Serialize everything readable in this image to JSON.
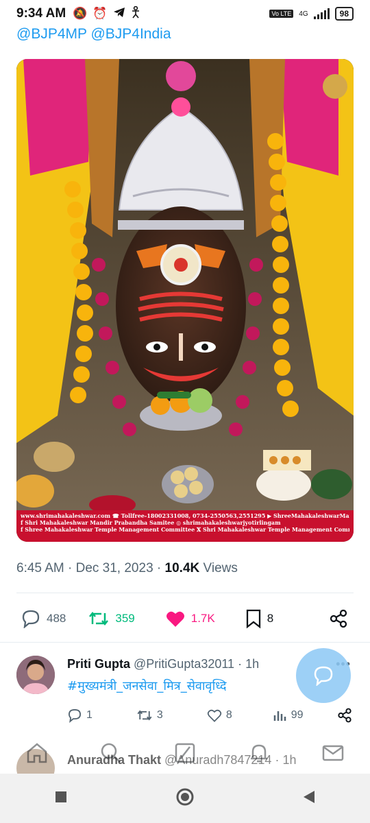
{
  "status_bar": {
    "time": "9:34 AM",
    "icons": [
      "mute-icon",
      "alarm-icon",
      "telegram-icon",
      "accessibility-icon"
    ],
    "volte": "Vo LTE",
    "network": "4G",
    "battery": "98"
  },
  "tweet": {
    "mentions": "@BJP4MP @BJP4India",
    "image_banner": {
      "line1": "www.shrimahakaleshwar.com ☎ Tollfree-18002331008, 0734-2550563,2551295  ▶ ShreeMahakaleshwarMandir",
      "line2": "f  Shri Mahakaleshwar Mandir Prabandha Samitee  ◎ shrimahakaleshwarjyotirlingam",
      "line3": "f  Shree Mahakaleshwar Temple Management Committee  𝕏 Shri Mahakaleshwar Temple Management Committee"
    },
    "time": "6:45 AM",
    "date": "Dec 31, 2023",
    "views_count": "10.4K",
    "views_label": "Views",
    "stats": {
      "replies": "488",
      "retweets": "359",
      "likes": "1.7K",
      "bookmarks": "8"
    }
  },
  "reply": {
    "display_name": "Priti Gupta",
    "handle": "@PritiGupta32011",
    "age": "1h",
    "text": "#मुख्यमंत्री_जनसेवा_मित्र_सेवावृध्दि",
    "replies": "1",
    "retweets": "3",
    "likes": "8",
    "views": "99"
  },
  "reply2": {
    "display_name": "Anuradha Thakt",
    "handle": "@Anuradh7847214",
    "age": "1h"
  },
  "colors": {
    "link": "#1d9bf0",
    "retweet": "#00ba7c",
    "like": "#f91880",
    "muted": "#536471"
  }
}
